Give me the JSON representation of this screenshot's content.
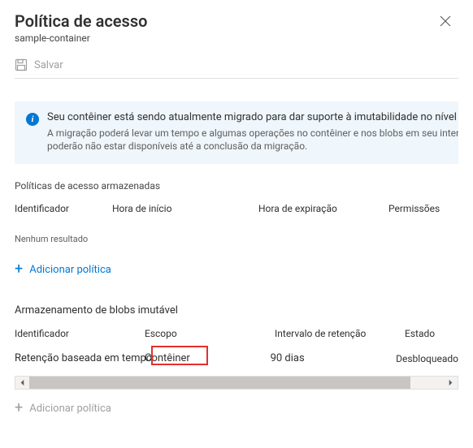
{
  "header": {
    "title": "Política de acesso",
    "subtitle": "sample-container"
  },
  "toolbar": {
    "save_label": "Salvar"
  },
  "info": {
    "title": "Seu contêiner está sendo atualmente migrado para dar suporte à imutabilidade no nível de ver",
    "body": "A migração poderá levar um tempo e algumas operações no contêiner e nos blobs em seu interior poderão não estar disponíveis até a conclusão da migração."
  },
  "stored_policies": {
    "section_label": "Políticas de acesso armazenadas",
    "columns": {
      "id": "Identificador",
      "start": "Hora de início",
      "expiry": "Hora de expiração",
      "permissions": "Permissões"
    },
    "no_results": "Nenhum resultado",
    "add_label": "Adicionar política"
  },
  "immutable": {
    "section_label": "Armazenamento de blobs imutável",
    "columns": {
      "id": "Identificador",
      "scope": "Escopo",
      "retention": "Intervalo de retenção",
      "state": "Estado"
    },
    "rows": [
      {
        "id": "Retenção baseada em tempo",
        "scope": "Contêiner",
        "retention": "90 dias",
        "state": "Desbloqueado"
      }
    ],
    "add_label": "Adicionar política"
  }
}
